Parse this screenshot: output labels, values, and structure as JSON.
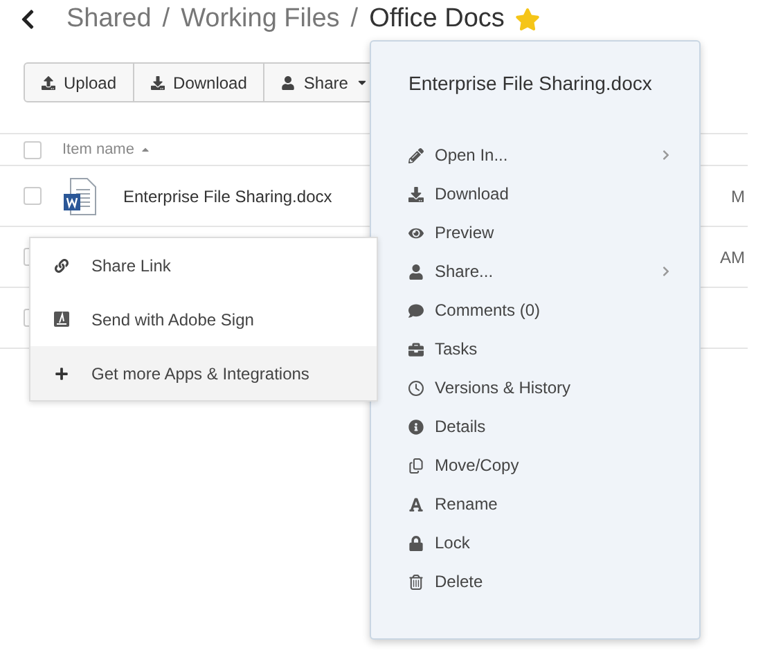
{
  "breadcrumb": {
    "items": [
      "Shared",
      "Working Files",
      "Office Docs"
    ],
    "separator": "/",
    "starred": true
  },
  "toolbar": [
    {
      "label": "Upload",
      "has_menu": false
    },
    {
      "label": "Download",
      "has_menu": false
    },
    {
      "label": "Share",
      "has_menu": true
    }
  ],
  "table": {
    "select_all": {
      "checked": false
    },
    "columns": [
      {
        "label": "Item name",
        "sorted": true
      }
    ],
    "rows": [
      {
        "name": "Enterprise File Sharing.docx",
        "time": "M",
        "checked": false
      },
      {
        "time": "AM",
        "checked": false
      },
      {
        "checked": false
      }
    ]
  },
  "context_menu": {
    "title": "Enterprise File Sharing.docx",
    "items": [
      {
        "label": "Open In...",
        "submenu": true
      },
      {
        "label": "Download",
        "submenu": false
      },
      {
        "label": "Preview",
        "submenu": false
      },
      {
        "label": "Share...",
        "submenu": true
      },
      {
        "label": "Comments (0)",
        "submenu": false
      },
      {
        "label": "Tasks",
        "submenu": false
      },
      {
        "label": "Versions & History",
        "submenu": false
      },
      {
        "label": "Details",
        "submenu": false
      },
      {
        "label": "Move/Copy",
        "submenu": false
      },
      {
        "label": "Rename",
        "submenu": false
      },
      {
        "label": "Lock",
        "submenu": false
      },
      {
        "label": "Delete",
        "submenu": false
      }
    ]
  },
  "share_menu": [
    {
      "label": "Share Link",
      "selected": false
    },
    {
      "label": "Send with Adobe Sign",
      "selected": false
    },
    {
      "label": "Get more Apps & Integrations",
      "selected": true
    }
  ]
}
